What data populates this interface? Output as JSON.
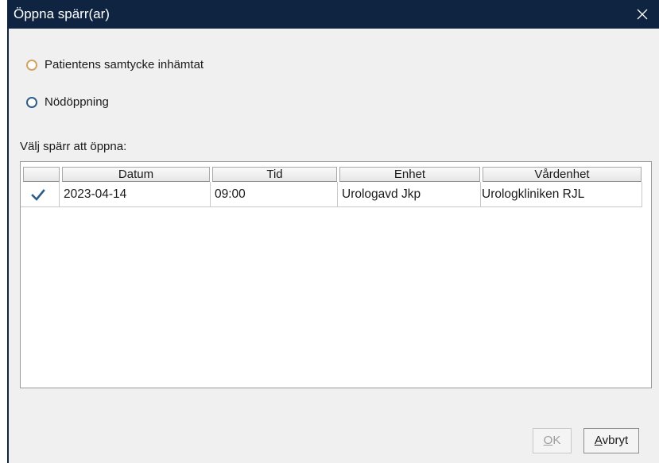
{
  "dialog": {
    "title": "Öppna spärr(ar)"
  },
  "options": {
    "consent_label": "Patientens samtycke inhämtat",
    "emergency_label": "Nödöppning"
  },
  "table": {
    "label": "Välj spärr att öppna:",
    "columns": [
      "Datum",
      "Tid",
      "Enhet",
      "Vårdenhet"
    ],
    "rows": [
      {
        "checked": true,
        "datum": "2023-04-14",
        "tid": "09:00",
        "enhet": "Urologavd Jkp",
        "vardenhet": "Urologkliniken RJL"
      }
    ]
  },
  "buttons": {
    "ok_mnemonic": "O",
    "ok_rest": "K",
    "cancel_mnemonic": "A",
    "cancel_rest": "vbryt"
  },
  "colors": {
    "titlebar": "#0e2440",
    "checkmark": "#2f5c86"
  }
}
